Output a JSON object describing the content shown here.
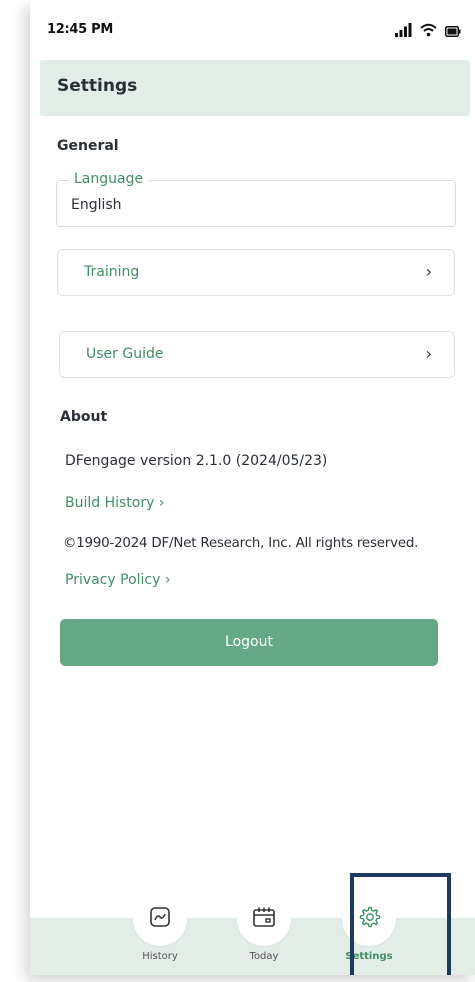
{
  "status_bar": {
    "time": "12:45 PM"
  },
  "header": {
    "title": "Settings"
  },
  "general": {
    "section_title": "General",
    "language": {
      "label": "Language",
      "value": "English"
    },
    "items": [
      {
        "label": "Training"
      },
      {
        "label": "User Guide"
      }
    ],
    "chevron": "›"
  },
  "about": {
    "section_title": "About",
    "version": "DFengage version 2.1.0 (2024/05/23)",
    "build_history": "Build History ›",
    "copyright": "©1990-2024 DF/Net Research, Inc. All rights reserved.",
    "privacy_policy": "Privacy Policy ›"
  },
  "logout": {
    "label": "Logout"
  },
  "tabs": [
    {
      "label": "History",
      "icon": "chart-icon",
      "active": false
    },
    {
      "label": "Today",
      "icon": "calendar-icon",
      "active": false
    },
    {
      "label": "Settings",
      "icon": "gear-icon",
      "active": true
    }
  ],
  "colors": {
    "accent": "#3f8f63",
    "button": "#65a886",
    "header_bg": "#e2ede8",
    "highlight": "#1f3a5f"
  }
}
